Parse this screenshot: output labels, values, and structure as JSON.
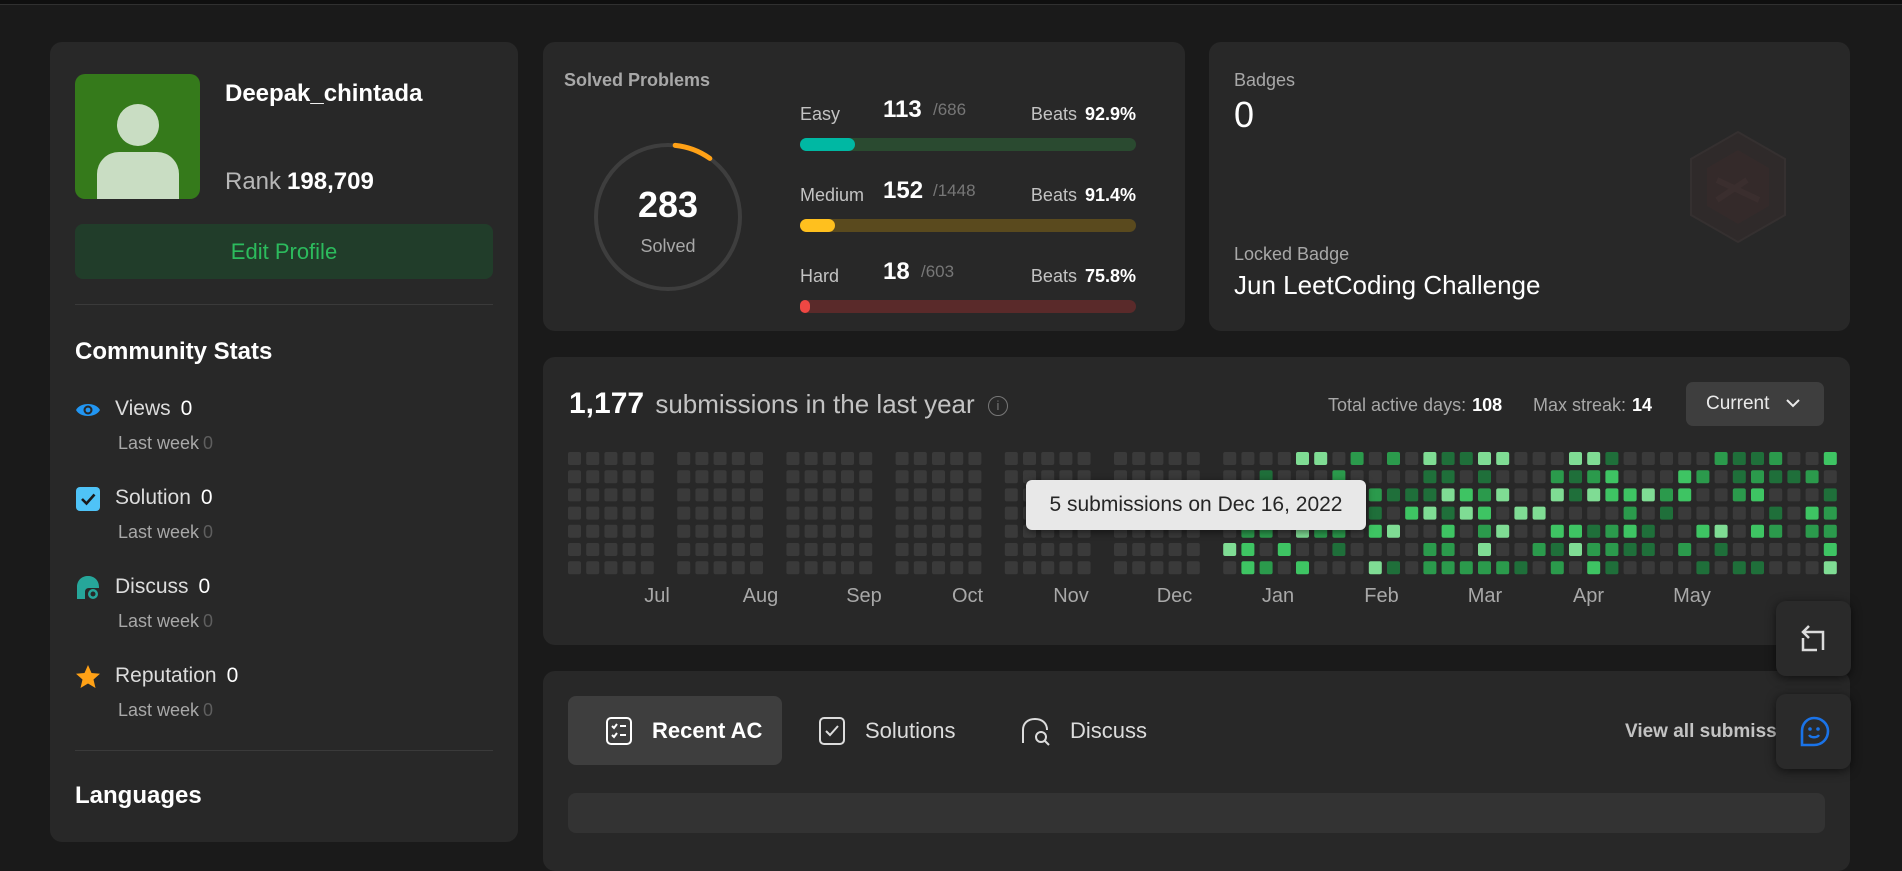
{
  "profile": {
    "username": "Deepak_chintada",
    "rank_label": "Rank",
    "rank_value": "198,709",
    "edit_label": "Edit Profile"
  },
  "community": {
    "title": "Community Stats",
    "last_week_label": "Last week",
    "items": [
      {
        "icon": "eye-icon",
        "label": "Views",
        "value": "0",
        "last_week": "0"
      },
      {
        "icon": "checkbox-icon",
        "label": "Solution",
        "value": "0",
        "last_week": "0"
      },
      {
        "icon": "discuss-icon",
        "label": "Discuss",
        "value": "0",
        "last_week": "0"
      },
      {
        "icon": "star-icon",
        "label": "Reputation",
        "value": "0",
        "last_week": "0"
      }
    ]
  },
  "languages": {
    "title": "Languages"
  },
  "solved": {
    "title": "Solved Problems",
    "total": "283",
    "total_label": "Solved",
    "beats_label": "Beats",
    "difficulties": [
      {
        "name": "Easy",
        "count": "113",
        "total": "/686",
        "beats": "92.9%",
        "fraction": 0.165,
        "color": "#00b8a3",
        "track": "#2a4a30"
      },
      {
        "name": "Medium",
        "count": "152",
        "total": "/1448",
        "beats": "91.4%",
        "fraction": 0.105,
        "color": "#ffc01e",
        "track": "#5a4a1e"
      },
      {
        "name": "Hard",
        "count": "18",
        "total": "/603",
        "beats": "75.8%",
        "fraction": 0.03,
        "color": "#ef4743",
        "track": "#5a2a2a"
      }
    ]
  },
  "badges": {
    "title": "Badges",
    "count": "0",
    "locked_label": "Locked Badge",
    "locked_name": "Jun LeetCoding Challenge"
  },
  "submissions": {
    "count": "1,177",
    "text": "submissions in the last year",
    "active_label": "Total active days:",
    "active_value": "108",
    "streak_label": "Max streak:",
    "streak_value": "14",
    "period": "Current",
    "months": [
      "Jul",
      "Aug",
      "Sep",
      "Oct",
      "Nov",
      "Dec",
      "Jan",
      "Feb",
      "Mar",
      "Apr",
      "May"
    ],
    "tooltip": "5 submissions on Dec 16, 2022"
  },
  "tabs": {
    "items": [
      {
        "label": "Recent AC",
        "icon": "recent-ac-icon"
      },
      {
        "label": "Solutions",
        "icon": "solutions-icon"
      },
      {
        "label": "Discuss",
        "icon": "discuss-tab-icon"
      }
    ],
    "view_all": "View all submissions"
  },
  "colors": {
    "accent_green": "#2cbb5d",
    "easy": "#00b8a3",
    "medium": "#ffc01e",
    "hard": "#ef4743",
    "card_bg": "#282828"
  }
}
